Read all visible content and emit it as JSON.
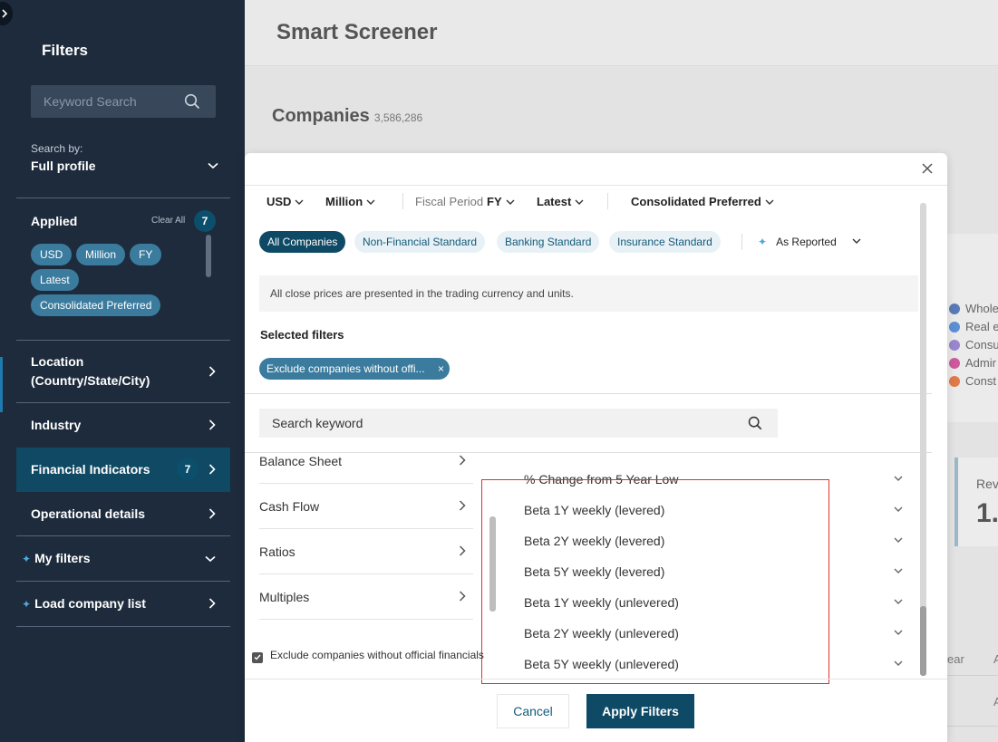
{
  "page": {
    "title": "Smart Screener",
    "companies_label": "Companies",
    "companies_count": "3,586,286",
    "legend": [
      {
        "label": "Whole",
        "color": "#5a7bb5"
      },
      {
        "label": "Real e",
        "color": "#5b8fd6"
      },
      {
        "label": "Consu",
        "color": "#9a86cc"
      },
      {
        "label": "Admir",
        "color": "#cc5a9c"
      },
      {
        "label": "Const",
        "color": "#e07a4a"
      }
    ],
    "revenue_label": "Rev",
    "revenue_value": "1.",
    "table_col_year": "ear",
    "table_col_a": "A",
    "table_cell_a": "A"
  },
  "sidebar": {
    "title": "Filters",
    "search_placeholder": "Keyword Search",
    "search_by_label": "Search by:",
    "search_by_value": "Full profile",
    "applied_label": "Applied",
    "clear_all": "Clear All",
    "applied_count": "7",
    "applied_chips": [
      "USD",
      "Million",
      "FY",
      "Latest",
      "Consolidated Preferred"
    ],
    "nav": {
      "location": "Location\n(Country/State/City)",
      "industry": "Industry",
      "financial": "Financial Indicators",
      "financial_count": "7",
      "operational": "Operational details",
      "my_filters": "My filters",
      "load_list": "Load company list"
    }
  },
  "modal": {
    "toolbar": {
      "currency": "USD",
      "unit": "Million",
      "fiscal_label": "Fiscal Period",
      "fiscal_value": "FY",
      "period": "Latest",
      "consolidation": "Consolidated Preferred"
    },
    "templates": [
      "All Companies",
      "Non-Financial Standard",
      "Banking Standard",
      "Insurance Standard"
    ],
    "as_reported": "As Reported",
    "info": "All close prices are presented in the trading currency and units.",
    "selected_label": "Selected filters",
    "selected_chip": "Exclude companies without offi...",
    "search_placeholder": "Search keyword",
    "categories": [
      "Balance Sheet",
      "Cash Flow",
      "Ratios",
      "Multiples"
    ],
    "indicators": [
      "% Change from 5 Year Low",
      "Beta 1Y weekly (levered)",
      "Beta 2Y weekly (levered)",
      "Beta 5Y weekly (levered)",
      "Beta 1Y weekly (unlevered)",
      "Beta 2Y weekly (unlevered)",
      "Beta 5Y weekly (unlevered)"
    ],
    "exclude_label": "Exclude companies without official financials",
    "cancel": "Cancel",
    "apply": "Apply Filters"
  },
  "icons": {
    "close": "close-icon",
    "search": "search-icon",
    "chevron_down": "chevron-down-icon",
    "chevron_right": "chevron-right-icon",
    "sparkle": "sparkle-icon",
    "check": "check-icon"
  },
  "colors": {
    "sidebar_bg": "#1d2b3c",
    "accent": "#0e4a66",
    "chip": "#3b7c9e",
    "highlight_box": "#e0312c"
  }
}
